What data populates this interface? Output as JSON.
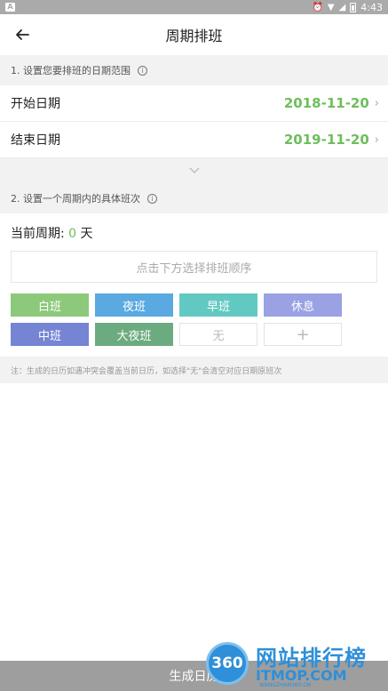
{
  "status_bar": {
    "left_glyph": "A",
    "time": "4:43"
  },
  "header": {
    "title": "周期排班"
  },
  "section1": {
    "heading": "1. 设置您要排班的日期范围",
    "start_label": "开始日期",
    "start_value": "2018-11-20",
    "end_label": "结束日期",
    "end_value": "2019-11-20"
  },
  "section2": {
    "heading": "2. 设置一个周期内的具体班次",
    "cycle_prefix": "当前周期: ",
    "cycle_days": "0",
    "cycle_unit": " 天",
    "order_placeholder": "点击下方选择排班顺序"
  },
  "shifts": [
    {
      "label": "白班",
      "color": "#8cc97a"
    },
    {
      "label": "夜班",
      "color": "#5aa9e0"
    },
    {
      "label": "早班",
      "color": "#62c9c2"
    },
    {
      "label": "休息",
      "color": "#9aa2e3"
    },
    {
      "label": "中班",
      "color": "#7585d4"
    },
    {
      "label": "大夜班",
      "color": "#6cab7f"
    },
    {
      "label": "无",
      "color": "#ffffff"
    },
    {
      "label": "+",
      "color": "#ffffff"
    }
  ],
  "note": "注：生成的日历如遇冲突会覆盖当前日历，如选择\"无\"会清空对应日期原班次",
  "bottom_button": "生成日历",
  "watermark": {
    "logo": "360",
    "cn": "网站排行榜",
    "en": "ITMOP.COM",
    "small": "WANGZHAN360.CN"
  },
  "colors": {
    "accent_green": "#6cbf5b",
    "status_bar": "#aaaaaa",
    "bottom_bar": "#9e9e9e"
  }
}
